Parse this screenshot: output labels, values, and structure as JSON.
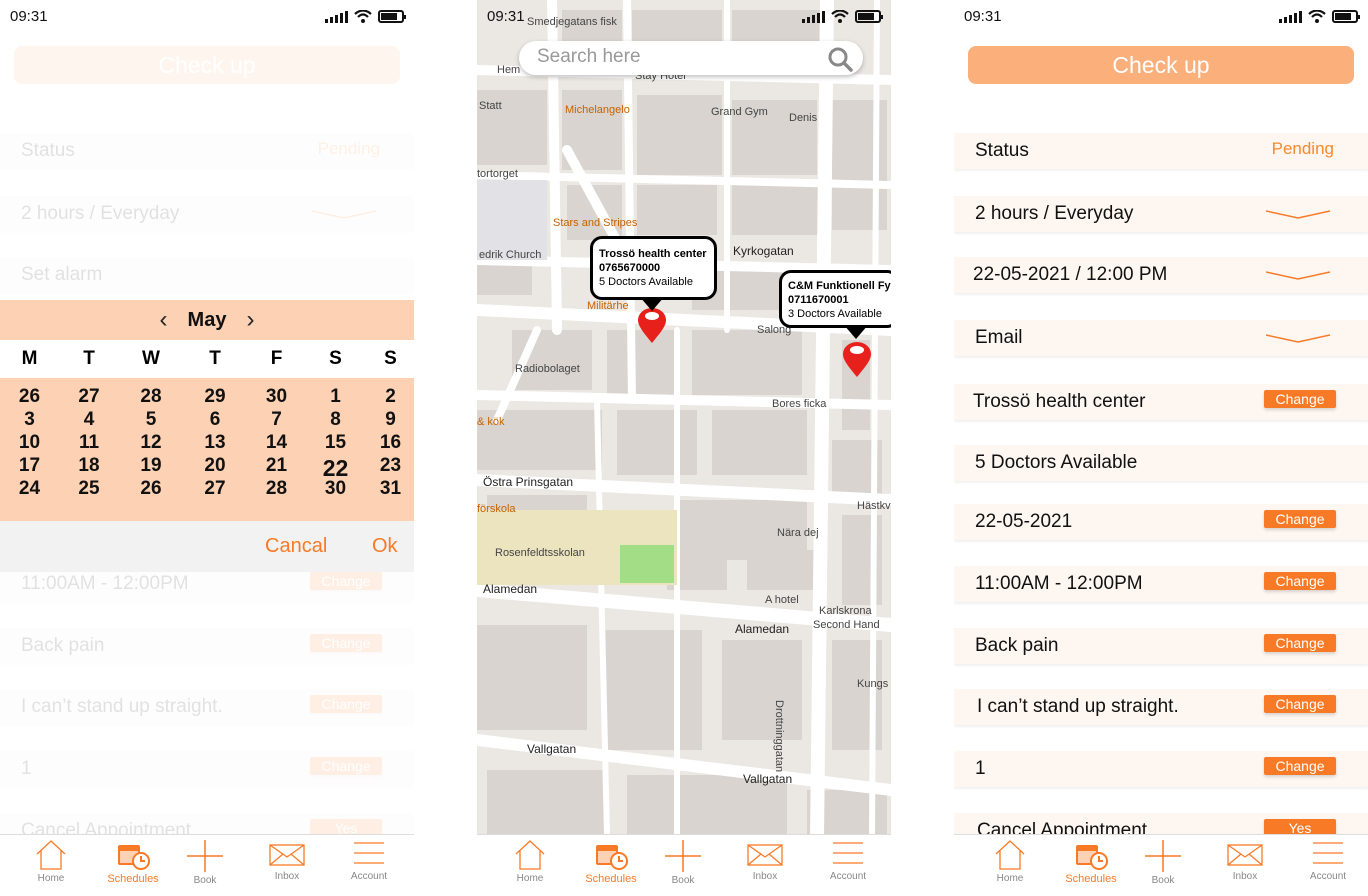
{
  "status_bar": {
    "time": "09:31"
  },
  "header": {
    "title": "Check up"
  },
  "form": {
    "status_label": "Status",
    "status_value": "Pending",
    "frequency": "2 hours / Everyday",
    "alarm_placeholder": "Set alarm",
    "datetime": "22-05-2021 / 12:00 PM",
    "reminder": "Email",
    "center": "Trossö health center",
    "doctors": "5 Doctors Available",
    "date": "22-05-2021",
    "time_slot": "11:00AM - 12:00PM",
    "reason": "Back pain",
    "notes": "I can’t stand up straight.",
    "count": "1",
    "cancel_label": "Cancel Appointment",
    "change_label": "Change",
    "yes_label": "Yes"
  },
  "calendar": {
    "month": "May",
    "weekdays": [
      "M",
      "T",
      "W",
      "T",
      "F",
      "S",
      "S"
    ],
    "days": [
      [
        "26",
        "27",
        "28",
        "29",
        "30",
        "1",
        "2"
      ],
      [
        "3",
        "4",
        "5",
        "6",
        "7",
        "8",
        "9"
      ],
      [
        "10",
        "11",
        "12",
        "13",
        "14",
        "15",
        "16"
      ],
      [
        "17",
        "18",
        "19",
        "20",
        "21",
        "22",
        "23"
      ],
      [
        "24",
        "25",
        "26",
        "27",
        "28",
        "30",
        "31"
      ]
    ],
    "selected_day": "22",
    "cancel": "Cancal",
    "ok": "Ok"
  },
  "map": {
    "search_placeholder": "Search here",
    "places": [
      {
        "name": "Trossö health center",
        "phone": "0765670000",
        "doctors": "5 Doctors Available"
      },
      {
        "name": "C&M Funktionell Fysi",
        "phone": "0711670001",
        "doctors": "3 Doctors Available"
      }
    ],
    "labels": {
      "smedjegatans": "Smedjegatans fisk",
      "hem": "Hem",
      "stay": "Stay Hotel",
      "statt": "Statt",
      "michelangelo": "Michelangelo",
      "grandgym": "Grand Gym",
      "denis": "Denis",
      "stortorget": "tortorget",
      "stars": "Stars and Stripes",
      "church": "edrik Church",
      "kyrkogatan": "Kyrkogatan",
      "militarhem": "Militärhe",
      "salong": "Salong",
      "radiobolaget": "Radiobolaget",
      "bores": "Bores ficka",
      "kok": "& kök",
      "ostra": "Östra Prinsgatan",
      "hastkv": "Hästkv",
      "forskola": "förskola",
      "rosenfeldt": "Rosenfeldtsskolan",
      "naradej": "Nära dej",
      "alamedan1": "Alamedan",
      "ahotel": "A hotel",
      "karlskrona": "Karlskrona",
      "secondhand": "Second Hand",
      "alamedan2": "Alamedan",
      "drottning": "Drottninggatan",
      "kungs": "Kungs",
      "vallgatan1": "Vallgatan",
      "vallgatan2": "Vallgatan"
    }
  },
  "tabs": [
    {
      "label": "Home",
      "icon": "home-icon"
    },
    {
      "label": "Schedules",
      "icon": "calendar-icon"
    },
    {
      "label": "Book",
      "icon": "plus-icon"
    },
    {
      "label": "Inbox",
      "icon": "mail-icon"
    },
    {
      "label": "Account",
      "icon": "menu-icon"
    }
  ],
  "colors": {
    "accent": "#f97a26",
    "header": "#fbb07b",
    "calendar_bg": "#fdd1b3",
    "pin": "#e8201c"
  }
}
